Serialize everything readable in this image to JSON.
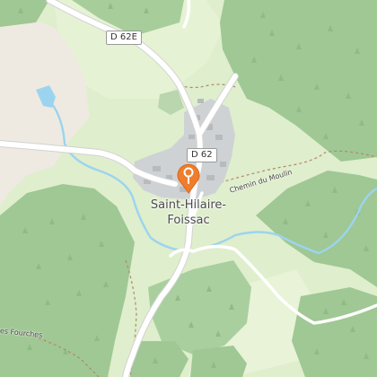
{
  "map": {
    "road_shields": [
      {
        "id": "d62e",
        "label": "D 62E"
      },
      {
        "id": "d62",
        "label": "D 62"
      }
    ],
    "village": {
      "name_line1": "Saint-Hilaire-",
      "name_line2": "Foissac"
    },
    "streets": {
      "chemin_du_moulin": "Chemin du Moulin",
      "les_fourches": "es Fourches"
    },
    "marker": {
      "icon": "map-pin-icon",
      "color": "#f07d2c"
    },
    "colors": {
      "meadow": "#dfeecc",
      "forest": "#9fc894",
      "bare_ground": "#eeeae2",
      "water": "#9cd4ef",
      "road": "#ffffff",
      "built_up": "#cfd2d4"
    }
  }
}
